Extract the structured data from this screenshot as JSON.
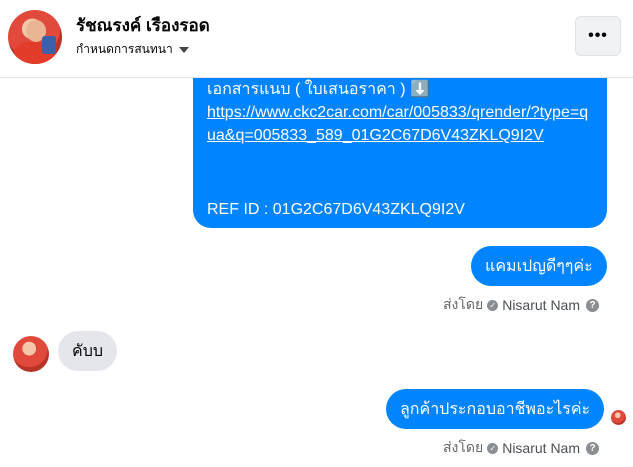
{
  "header": {
    "contact_name": "รัชณรงค์ เรืองรอด",
    "subtitle": "กำหนดการสนทนา",
    "menu_label": "•••"
  },
  "messages": {
    "attachment_partial_text": "เอกสารแนบ ( ใบเสนอราคา ) ⬇️",
    "link_text": "https://www.ckc2car.com/car/005833/qrender/?type=qua&q=005833_589_01G2C67D6V43ZKLQ9I2V",
    "ref_text": "REF ID : 01G2C67D6V43ZKLQ9I2V",
    "outgoing_1": "แคมเปญดีๆๆค่ะ",
    "incoming_1": "คับบ",
    "outgoing_2": "ลูกค้าประกอบอาชีพอะไรค่ะ"
  },
  "sent_by": {
    "prefix": "ส่งโดย",
    "sender": "Nisarut Nam",
    "help_icon": "?"
  },
  "colors": {
    "outgoing_bubble": "#0084ff",
    "incoming_bubble": "#e4e6eb"
  }
}
